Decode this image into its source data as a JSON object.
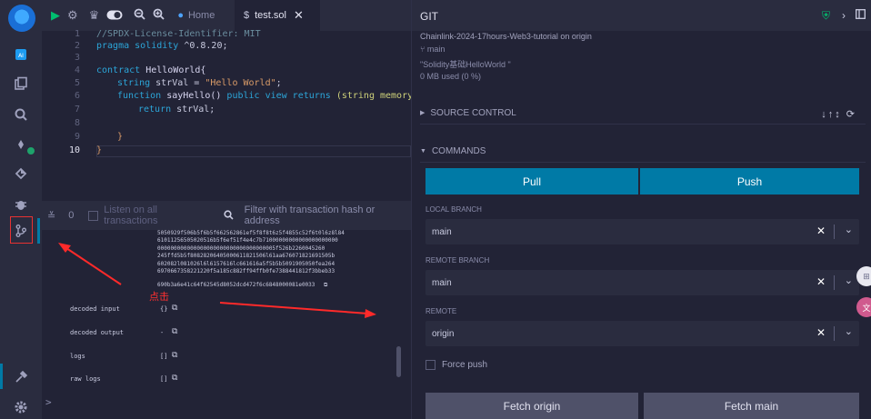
{
  "colors": {
    "accent": "#007aa6",
    "success": "#00bf6f",
    "annotation": "#ff2a2a"
  },
  "rail": {
    "icons": [
      "remix-logo-icon",
      "plugin-icon",
      "files-icon",
      "search-icon",
      "compiler-icon",
      "deploy-icon",
      "debugger-icon",
      "git-icon",
      "settings-tools-icon",
      "gear-icon"
    ]
  },
  "tabs": {
    "home": "Home",
    "file": "test.sol"
  },
  "editor": {
    "line_numbers": [
      "1",
      "2",
      "3",
      "4",
      "5",
      "6",
      "7",
      "8",
      "9",
      "10"
    ],
    "current_line": "10"
  },
  "code": {
    "l1": "//SPDX-License-Identifier: MIT",
    "l2_kw": "pragma solidity",
    "l2_ver": " ^0.8.20;",
    "l4_kw": "contract",
    "l4_name": " HelloWorld{",
    "l5_ty": "string",
    "l5_rest": " strVal = ",
    "l5_str": "\"Hello World\"",
    "l5_end": ";",
    "l6_kw": "function",
    "l6_name": " sayHello() ",
    "l6_mod": "public view returns",
    "l6_rest": " (string memory)",
    "l7_kw": "return",
    "l7_rest": " strVal;",
    "l9": "}",
    "l10": "}"
  },
  "terminal": {
    "count": "0",
    "listen_label": "Listen on all transactions",
    "filter_placeholder": "Filter with transaction hash or address",
    "hex_lines": [
      "5050929f506b5f6b5f662562861ef5f8f8t6z5f4855c52f6t0l6z8l84",
      "61011256505020516b5f6ef51f4e4c7b71000000000000000000000",
      "000000000000000000000000000000000005f526b2260045260",
      "245ffd5b5f80828206405000611821506l61aa676071821691505b",
      "602082l081026l6l6157616lc661616a5f5b5b5091905050fea264",
      "6970667358221220f5a185c882ff94ffb0fe7388441812f3bbeb33"
    ],
    "hex_end": "690b3a6e41c64f62545d8052dcd472f6c6848000081e0033",
    "rows": [
      {
        "label": "decoded input",
        "value": "{}"
      },
      {
        "label": "decoded output",
        "value": "-"
      },
      {
        "label": "logs",
        "value": "[]"
      },
      {
        "label": "raw logs",
        "value": "[]"
      }
    ]
  },
  "annotation": {
    "text": "点击"
  },
  "git": {
    "title": "GIT",
    "repo": "Chainlink-2024-17hours-Web3-tutorial on origin",
    "branch": "main",
    "commit_msg": "\"Solidity基础HelloWorld \"",
    "storage": "0 MB used (0 %)",
    "source_control": "SOURCE CONTROL",
    "commands": "COMMANDS",
    "pull": "Pull",
    "push": "Push",
    "local_branch_label": "LOCAL BRANCH",
    "local_branch": "main",
    "remote_branch_label": "REMOTE BRANCH",
    "remote_branch": "main",
    "remote_label": "REMOTE",
    "remote": "origin",
    "force_push": "Force push",
    "fetch_origin": "Fetch origin",
    "fetch_main": "Fetch main"
  }
}
